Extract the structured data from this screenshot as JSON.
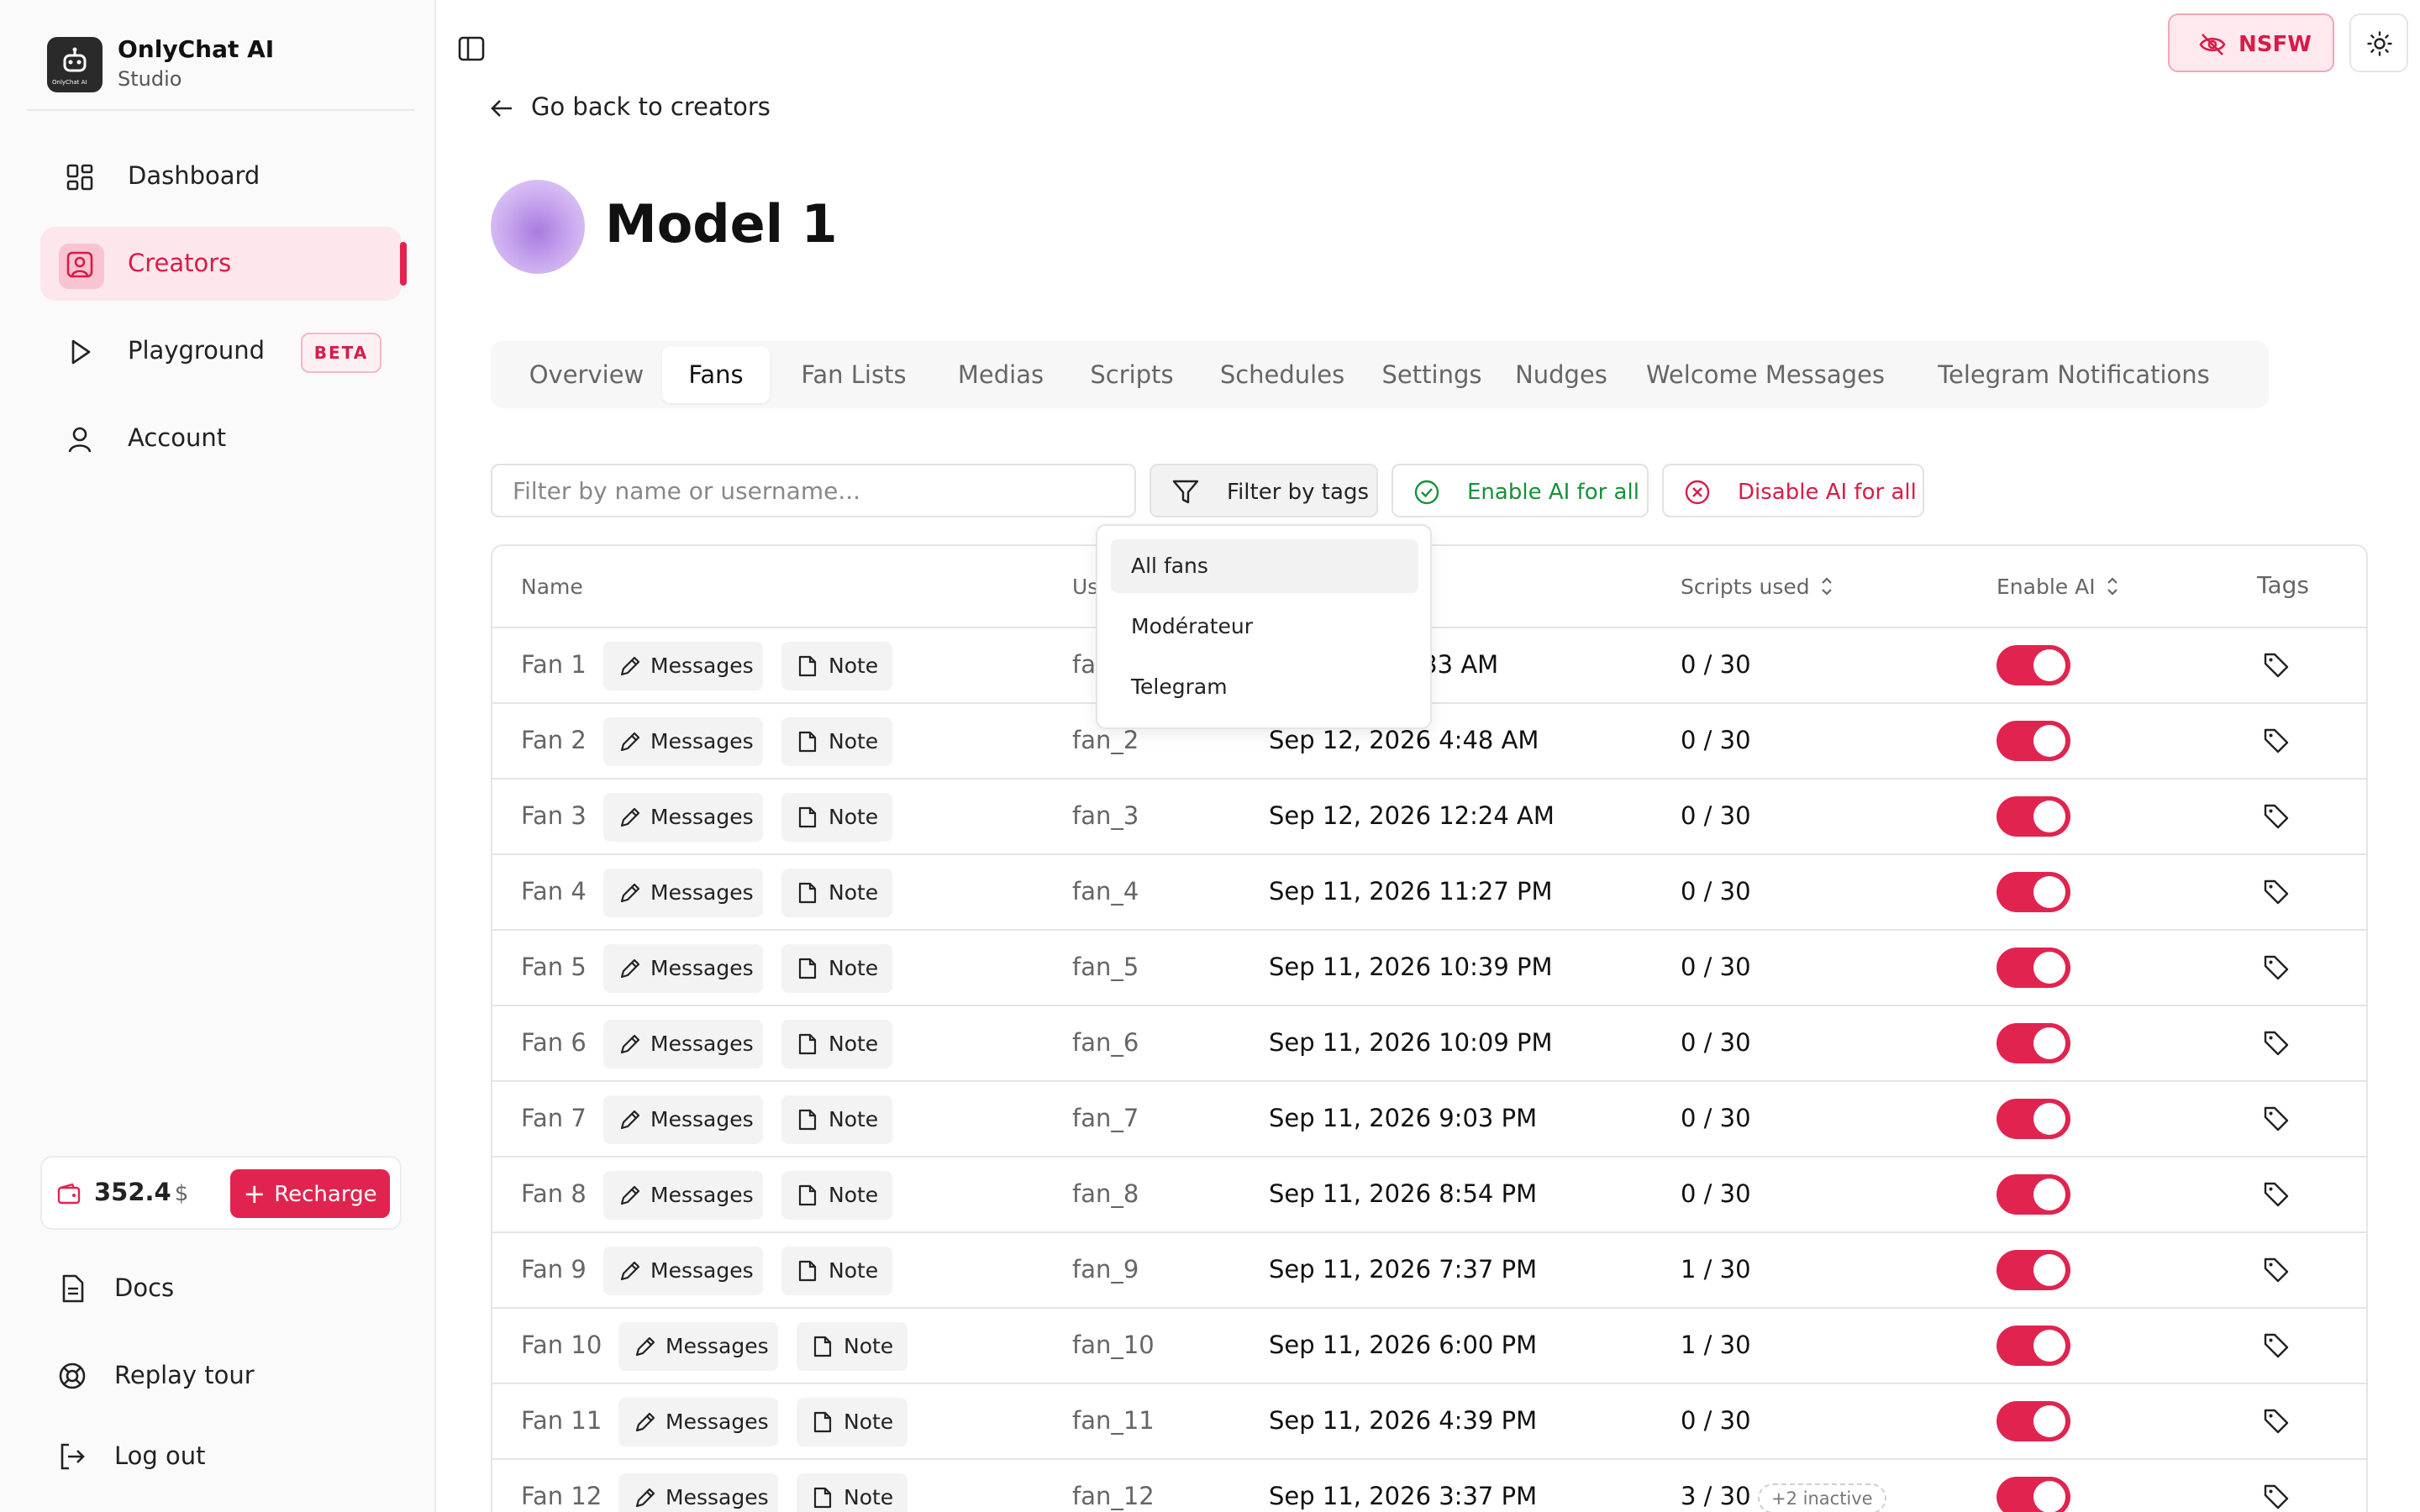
{
  "brand": {
    "name": "OnlyChat AI",
    "subtitle": "Studio",
    "logo_text": "OnlyChat AI"
  },
  "nav": {
    "items": [
      {
        "label": "Dashboard",
        "icon": "dashboard-icon"
      },
      {
        "label": "Creators",
        "icon": "creators-icon",
        "active": true
      },
      {
        "label": "Playground",
        "icon": "play-icon",
        "badge": "BETA"
      },
      {
        "label": "Account",
        "icon": "user-icon"
      }
    ]
  },
  "balance": {
    "amount": "352.4",
    "currency": "$",
    "recharge_label": "Recharge"
  },
  "footer": {
    "docs": "Docs",
    "replay_tour": "Replay tour",
    "logout": "Log out"
  },
  "topbar": {
    "nsfw_label": "NSFW"
  },
  "back_label": "Go back to creators",
  "model": {
    "title": "Model 1"
  },
  "tabs": [
    "Overview",
    "Fans",
    "Fan Lists",
    "Medias",
    "Scripts",
    "Schedules",
    "Settings",
    "Nudges",
    "Welcome Messages",
    "Telegram Notifications"
  ],
  "active_tab": "Fans",
  "filters": {
    "search_placeholder": "Filter by name or username...",
    "tags_label": "Filter by tags",
    "enable_all": "Enable AI for all",
    "disable_all": "Disable AI for all"
  },
  "dropdown": {
    "options": [
      "All fans",
      "Modérateur",
      "Telegram"
    ],
    "highlighted": "All fans"
  },
  "table": {
    "headers": {
      "name": "Name",
      "username": "Us",
      "scripts": "Scripts used",
      "enable_ai": "Enable AI",
      "tags": "Tags"
    },
    "messages_label": "Messages",
    "note_label": "Note",
    "rows": [
      {
        "name": "Fan 1",
        "username": "fan_1",
        "date": "8:33 AM",
        "scripts": "0 / 30",
        "ai": true
      },
      {
        "name": "Fan 2",
        "username": "fan_2",
        "date": "Sep 12, 2026 4:48 AM",
        "scripts": "0 / 30",
        "ai": true
      },
      {
        "name": "Fan 3",
        "username": "fan_3",
        "date": "Sep 12, 2026 12:24 AM",
        "scripts": "0 / 30",
        "ai": true
      },
      {
        "name": "Fan 4",
        "username": "fan_4",
        "date": "Sep 11, 2026 11:27 PM",
        "scripts": "0 / 30",
        "ai": true
      },
      {
        "name": "Fan 5",
        "username": "fan_5",
        "date": "Sep 11, 2026 10:39 PM",
        "scripts": "0 / 30",
        "ai": true
      },
      {
        "name": "Fan 6",
        "username": "fan_6",
        "date": "Sep 11, 2026 10:09 PM",
        "scripts": "0 / 30",
        "ai": true
      },
      {
        "name": "Fan 7",
        "username": "fan_7",
        "date": "Sep 11, 2026 9:03 PM",
        "scripts": "0 / 30",
        "ai": true
      },
      {
        "name": "Fan 8",
        "username": "fan_8",
        "date": "Sep 11, 2026 8:54 PM",
        "scripts": "0 / 30",
        "ai": true
      },
      {
        "name": "Fan 9",
        "username": "fan_9",
        "date": "Sep 11, 2026 7:37 PM",
        "scripts": "1 / 30",
        "ai": true
      },
      {
        "name": "Fan 10",
        "username": "fan_10",
        "date": "Sep 11, 2026 6:00 PM",
        "scripts": "1 / 30",
        "ai": true
      },
      {
        "name": "Fan 11",
        "username": "fan_11",
        "date": "Sep 11, 2026 4:39 PM",
        "scripts": "0 / 30",
        "ai": true
      },
      {
        "name": "Fan 12",
        "username": "fan_12",
        "date": "Sep 11, 2026 3:37 PM",
        "scripts": "3 / 30",
        "ai": true,
        "inactive": "+2 inactive"
      }
    ]
  },
  "colors": {
    "accent": "#e0244f",
    "accent_bg": "#fde6ec",
    "success": "#17913a"
  }
}
